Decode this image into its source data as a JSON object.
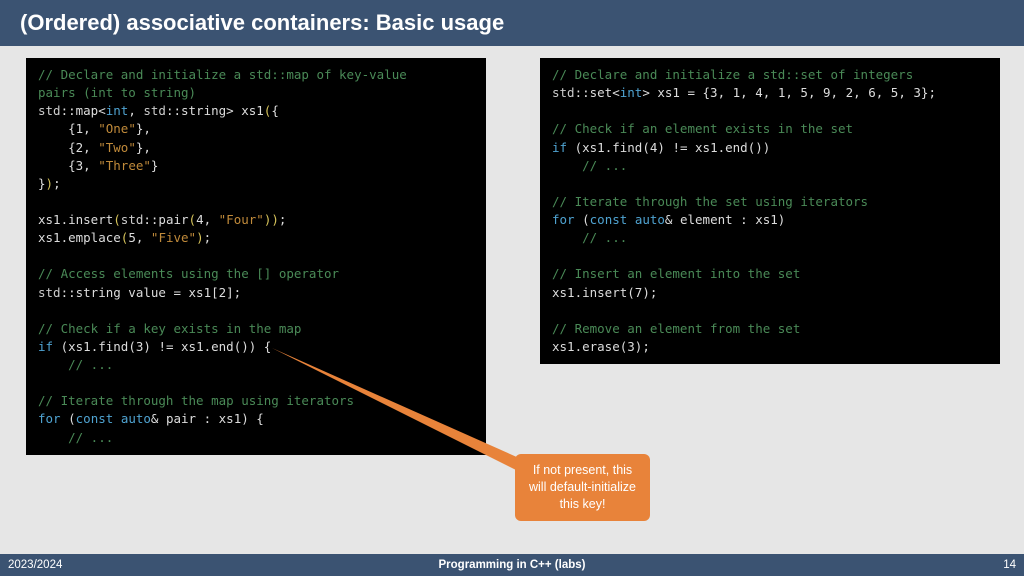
{
  "title": "(Ordered) associative containers: Basic usage",
  "footer": {
    "left": "2023/2024",
    "center": "Programming in C++ (labs)",
    "right": "14"
  },
  "callout": {
    "line1": "If not present, this",
    "line2": "will default-initialize",
    "line3": "this key!"
  },
  "left": {
    "l1": "// Declare and initialize a std::map of key-value",
    "l2": "pairs (int to string)",
    "l3a": "std",
    "l3b": "::map<",
    "l3c": "int",
    "l3d": ", ",
    "l3e": "std",
    "l3f": "::string> xs1",
    "l3g": "(",
    "l3h": "{",
    "l4a": "    {",
    "l4b": "1",
    "l4c": ", ",
    "l4d": "\"One\"",
    "l4e": "},",
    "l5a": "    {",
    "l5b": "2",
    "l5c": ", ",
    "l5d": "\"Two\"",
    "l5e": "},",
    "l6a": "    {",
    "l6b": "3",
    "l6c": ", ",
    "l6d": "\"Three\"",
    "l6e": "}",
    "l7a": "}",
    "l7b": ")",
    "l7c": ";",
    "l8": "",
    "l9a": "xs1.insert",
    "l9b": "(",
    "l9c": "std",
    "l9d": "::pair",
    "l9e": "(",
    "l9f": "4",
    "l9g": ", ",
    "l9h": "\"Four\"",
    "l9i": "))",
    "l9j": ";",
    "l10a": "xs1.emplace",
    "l10b": "(",
    "l10c": "5",
    "l10d": ", ",
    "l10e": "\"Five\"",
    "l10f": ")",
    "l10g": ";",
    "l11": "",
    "l12": "// Access elements using the [] operator",
    "l13a": "std",
    "l13b": "::string value = xs1[",
    "l13c": "2",
    "l13d": "];",
    "l14": "",
    "l15": "// Check if a key exists in the map",
    "l16a": "if",
    "l16b": " (xs1.find(",
    "l16c": "3",
    "l16d": ") != xs1.end()) {",
    "l17": "    // ...",
    "l18": "",
    "l19": "// Iterate through the map using iterators",
    "l20a": "for",
    "l20b": " (",
    "l20c": "const",
    "l20d": " ",
    "l20e": "auto",
    "l20f": "& pair : xs1) {",
    "l21": "    // ..."
  },
  "right": {
    "l1": "// Declare and initialize a std::set of integers",
    "l2a": "std",
    "l2b": "::set<",
    "l2c": "int",
    "l2d": "> xs1 = {",
    "l2e": "3",
    "l2f": ", ",
    "l2g": "1",
    "l2h": ", ",
    "l2i": "4",
    "l2j": ", ",
    "l2k": "1",
    "l2l": ", ",
    "l2m": "5",
    "l2n": ", ",
    "l2o": "9",
    "l2p": ", ",
    "l2q": "2",
    "l2r": ", ",
    "l2s": "6",
    "l2t": ", ",
    "l2u": "5",
    "l2v": ", ",
    "l2w": "3",
    "l2x": "};",
    "l3": "",
    "l4": "// Check if an element exists in the set",
    "l5a": "if",
    "l5b": " (xs1.find(",
    "l5c": "4",
    "l5d": ") != xs1.end())",
    "l6": "    // ...",
    "l7": "",
    "l8": "// Iterate through the set using iterators",
    "l9a": "for",
    "l9b": " (",
    "l9c": "const",
    "l9d": " ",
    "l9e": "auto",
    "l9f": "& element : xs1)",
    "l10": "    // ...",
    "l11": "",
    "l12": "// Insert an element into the set",
    "l13a": "xs1.insert(",
    "l13b": "7",
    "l13c": ");",
    "l14": "",
    "l15": "// Remove an element from the set",
    "l16a": "xs1.erase(",
    "l16b": "3",
    "l16c": ");"
  }
}
